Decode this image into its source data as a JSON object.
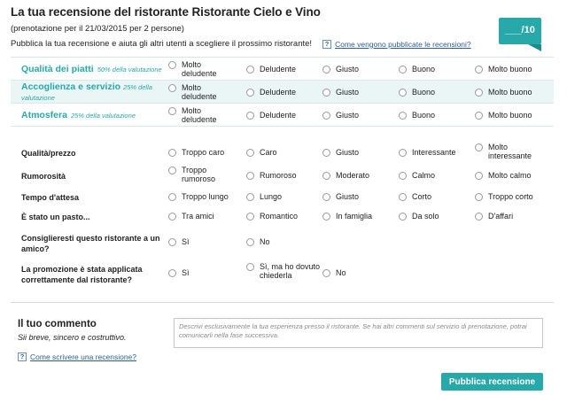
{
  "header": {
    "title": "La tua recensione del ristorante Ristorante Cielo e Vino",
    "subtitle": "(prenotazione per il 21/03/2015 per 2 persone)",
    "intro": "Pubblica la tua recensione e aiuta gli altri utenti a scegliere il prossimo ristorante!",
    "help_link": "Come vengono pubblicate le recensioni?"
  },
  "score_badge": "___/10",
  "help_icon_glyph": "?",
  "main_ratings": [
    {
      "label": "Qualità dei piatti",
      "weight": "50% della valutazione",
      "options": [
        "Molto deludente",
        "Deludente",
        "Giusto",
        "Buono",
        "Molto buono"
      ]
    },
    {
      "label": "Accoglienza e servizio",
      "weight": "25% della valutazione",
      "options": [
        "Molto deludente",
        "Deludente",
        "Giusto",
        "Buono",
        "Molto buono"
      ]
    },
    {
      "label": "Atmosfera",
      "weight": "25% della valutazione",
      "options": [
        "Molto deludente",
        "Deludente",
        "Giusto",
        "Buono",
        "Molto buono"
      ]
    }
  ],
  "secondary_ratings": [
    {
      "label": "Qualità/prezzo",
      "options": [
        "Troppo caro",
        "Caro",
        "Giusto",
        "Interessante",
        "Molto interessante"
      ]
    },
    {
      "label": "Rumorosità",
      "options": [
        "Troppo rumoroso",
        "Rumoroso",
        "Moderato",
        "Calmo",
        "Molto calmo"
      ]
    },
    {
      "label": "Tempo d'attesa",
      "options": [
        "Troppo lungo",
        "Lungo",
        "Giusto",
        "Corto",
        "Troppo corto"
      ]
    },
    {
      "label": "È stato un pasto...",
      "options": [
        "Tra amici",
        "Romantico",
        "In famiglia",
        "Da solo",
        "D'affari"
      ]
    },
    {
      "label": "Consiglieresti questo ristorante a un amico?",
      "options": [
        "Sì",
        "No"
      ]
    },
    {
      "label": "La promozione è stata applicata correttamente dal ristorante?",
      "options": [
        "Sì",
        "Sì, ma ho dovuto chiederla",
        "No"
      ]
    }
  ],
  "comment": {
    "title": "Il tuo commento",
    "hint": "Sii breve, sincero e costruttivo.",
    "placeholder": "Descrivi esclusivamente la tua esperienza presso il ristorante. Se hai altri commenti sul servizio di prenotazione, potrai comunicarli nella fase successiva.",
    "help_link": "Come scrivere una recensione?"
  },
  "publish_label": "Pubblica recensione",
  "colors": {
    "accent": "#27a9a9",
    "link": "#2b5d94",
    "row_shade": "#eaf5f5"
  }
}
